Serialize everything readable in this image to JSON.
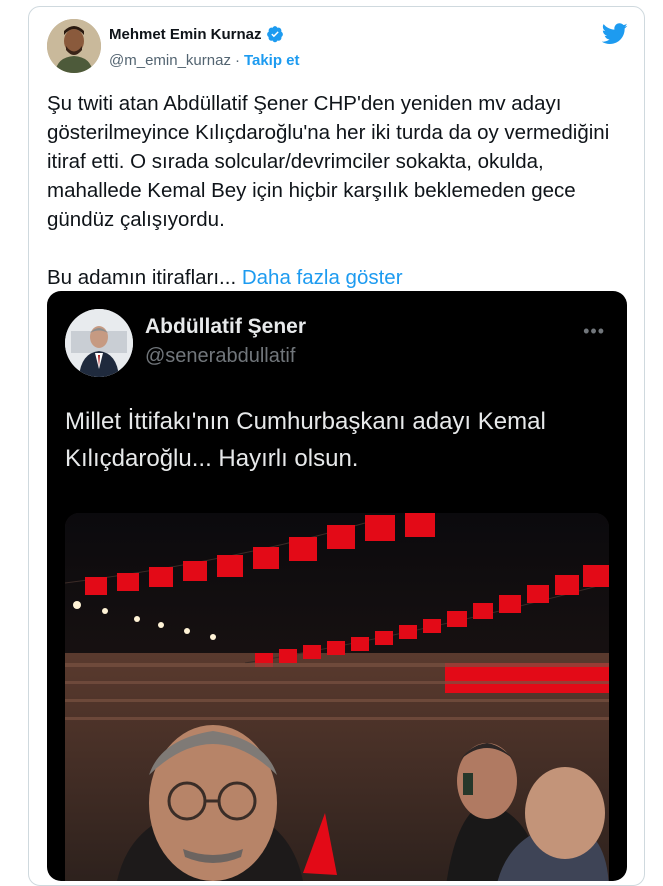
{
  "tweet": {
    "author_name": "Mehmet Emin Kurnaz",
    "author_handle": "@m_emin_kurnaz",
    "separator": "·",
    "follow_label": "Takip et",
    "body_paragraph_1": "Şu twiti atan Abdüllatif Şener CHP'den yeniden mv adayı gösterilmeyince Kılıçdaroğlu'na her iki turda da oy vermediğini itiraf etti. O sırada solcular/devrimciler sokakta, okulda, mahallede Kemal Bey için hiçbir karşılık beklemeden gece gündüz çalışıyordu.",
    "body_paragraph_2": "Bu adamın itirafları...",
    "show_more_label": "Daha fazla göster"
  },
  "embedded_tweet": {
    "author_name": "Abdüllatif Şener",
    "author_handle": "@senerabdullatif",
    "more_icon": "•••",
    "text": "Millet İttifakı'nın Cumhurbaşkanı adayı Kemal Kılıçdaroğlu... Hayırlı olsun."
  },
  "colors": {
    "accent": "#1d9bf0",
    "embed_background": "#000000",
    "flag_red": "#e30a17"
  },
  "icons": {
    "verified": "verified-badge-icon",
    "brand": "twitter-bird-icon",
    "more": "more-dots-icon"
  }
}
